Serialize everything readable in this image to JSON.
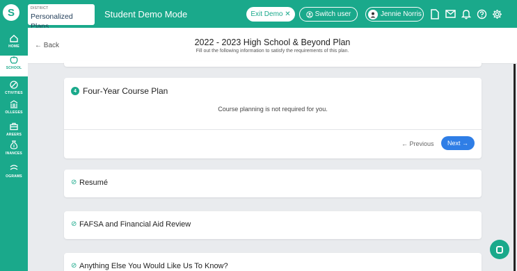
{
  "topbar": {
    "logo_glyph": "S",
    "district_label": "DISTRICT",
    "app_name": "Personalized Plans",
    "mode": "Student Demo Mode",
    "exit_demo": "Exit Demo ✕",
    "switch_user": "Switch user",
    "user_name": "Jennie Norris",
    "icons": [
      "document-icon",
      "mail-icon",
      "bell-icon",
      "help-icon",
      "settings-icon"
    ]
  },
  "sidebar": {
    "items": [
      {
        "label": "HOME",
        "icon": "home-icon"
      },
      {
        "label": "SCHOOL",
        "icon": "apple-icon",
        "active": true
      },
      {
        "label": "CTIVITIES",
        "icon": "activities-icon"
      },
      {
        "label": "OLLEGES",
        "icon": "college-icon"
      },
      {
        "label": "AREERS",
        "icon": "briefcase-icon"
      },
      {
        "label": "INANCES",
        "icon": "money-bag-icon"
      },
      {
        "label": "OGRAMS",
        "icon": "programs-icon"
      }
    ]
  },
  "header": {
    "back": "← Back",
    "title": "2022 - 2023 High School & Beyond Plan",
    "subtitle": "Fill out the following information to satisfy the requirements of this plan."
  },
  "course_plan": {
    "step": "4",
    "title": "Four-Year Course Plan",
    "message": "Course planning is not required for you.",
    "previous": "← Previous",
    "next": "Next →"
  },
  "sections": [
    {
      "title": "Resumé"
    },
    {
      "title": "FAFSA and Financial Aid Review"
    },
    {
      "title": "Anything Else You Would Like Us To Know?"
    }
  ],
  "colors": {
    "brand": "#1aa98b",
    "accent": "#2f7ee6"
  }
}
